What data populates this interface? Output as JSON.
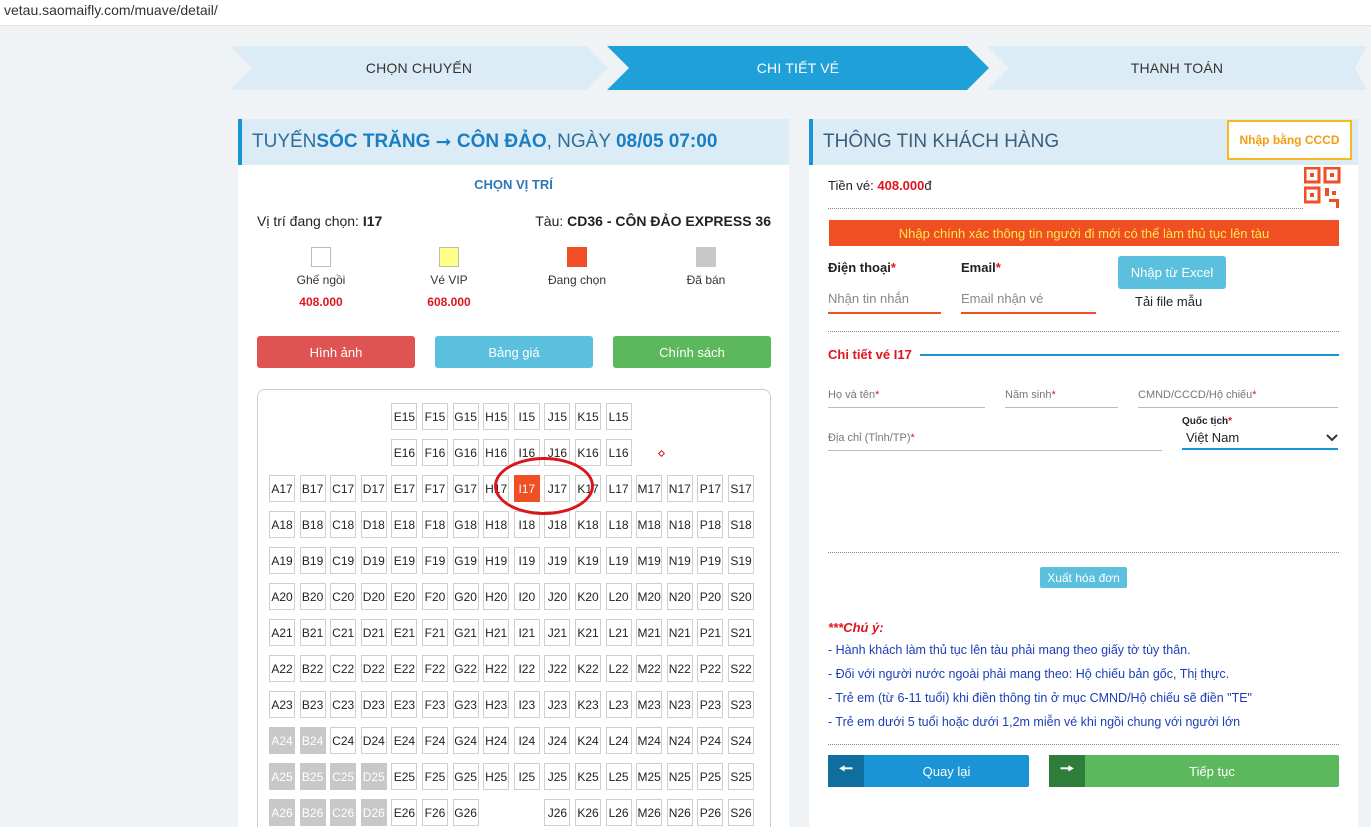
{
  "browser": {
    "url": "vetau.saomaifly.com/muave/detail/"
  },
  "steps": [
    "CHỌN CHUYẾN",
    "CHI TIẾT VÉ",
    "THANH TOÁN"
  ],
  "trip": {
    "prefix": "TUYẾN ",
    "from": "SÓC TRĂNG",
    "arrow": " ➞ ",
    "to": "CÔN ĐẢO",
    "date_prefix": ", NGÀY ",
    "datetime": "08/05 07:00"
  },
  "seat_section": {
    "title": "CHỌN VỊ TRÍ",
    "selected_label": "Vị trí đang chọn: ",
    "selected_value": "I17",
    "ship_label": "Tàu: ",
    "ship_value": "CD36 - CÔN ĐẢO EXPRESS 36"
  },
  "legend": [
    {
      "label": "Ghế ngồi",
      "price": "408.000",
      "color": "#ffffff"
    },
    {
      "label": "Vé VIP",
      "price": "608.000",
      "color": "#ffff88"
    },
    {
      "label": "Đang chọn",
      "price": "",
      "color": "#f04e23"
    },
    {
      "label": "Đã bán",
      "price": "",
      "color": "#c8c8c8"
    }
  ],
  "buttons": {
    "images": "Hình ảnh",
    "prices": "Bảng giá",
    "policy": "Chính sách"
  },
  "seatmap": {
    "columns": [
      "A",
      "B",
      "C",
      "D",
      "E",
      "F",
      "G",
      "H",
      "I",
      "J",
      "K",
      "L",
      "M",
      "N",
      "P",
      "S"
    ],
    "rows": [
      {
        "row": "15",
        "seats": [
          "E",
          "F",
          "G",
          "H",
          "I",
          "J",
          "K",
          "L"
        ]
      },
      {
        "row": "16",
        "seats": [
          "E",
          "F",
          "G",
          "H",
          "I",
          "J",
          "K",
          "L"
        ]
      },
      {
        "row": "17",
        "seats": [
          "A",
          "B",
          "C",
          "D",
          "E",
          "F",
          "G",
          "H",
          "I",
          "J",
          "K",
          "L",
          "M",
          "N",
          "P",
          "S"
        ]
      },
      {
        "row": "18",
        "seats": [
          "A",
          "B",
          "C",
          "D",
          "E",
          "F",
          "G",
          "H",
          "I",
          "J",
          "K",
          "L",
          "M",
          "N",
          "P",
          "S"
        ]
      },
      {
        "row": "19",
        "seats": [
          "A",
          "B",
          "C",
          "D",
          "E",
          "F",
          "G",
          "H",
          "I",
          "J",
          "K",
          "L",
          "M",
          "N",
          "P",
          "S"
        ]
      },
      {
        "row": "20",
        "seats": [
          "A",
          "B",
          "C",
          "D",
          "E",
          "F",
          "G",
          "H",
          "I",
          "J",
          "K",
          "L",
          "M",
          "N",
          "P",
          "S"
        ]
      },
      {
        "row": "21",
        "seats": [
          "A",
          "B",
          "C",
          "D",
          "E",
          "F",
          "G",
          "H",
          "I",
          "J",
          "K",
          "L",
          "M",
          "N",
          "P",
          "S"
        ]
      },
      {
        "row": "22",
        "seats": [
          "A",
          "B",
          "C",
          "D",
          "E",
          "F",
          "G",
          "H",
          "I",
          "J",
          "K",
          "L",
          "M",
          "N",
          "P",
          "S"
        ]
      },
      {
        "row": "23",
        "seats": [
          "A",
          "B",
          "C",
          "D",
          "E",
          "F",
          "G",
          "H",
          "I",
          "J",
          "K",
          "L",
          "M",
          "N",
          "P",
          "S"
        ]
      },
      {
        "row": "24",
        "seats": [
          "A",
          "B",
          "C",
          "D",
          "E",
          "F",
          "G",
          "H",
          "I",
          "J",
          "K",
          "L",
          "M",
          "N",
          "P",
          "S"
        ]
      },
      {
        "row": "25",
        "seats": [
          "A",
          "B",
          "C",
          "D",
          "E",
          "F",
          "G",
          "H",
          "I",
          "J",
          "K",
          "L",
          "M",
          "N",
          "P",
          "S"
        ]
      },
      {
        "row": "26",
        "seats": [
          "A",
          "B",
          "C",
          "D",
          "E",
          "F",
          "G",
          "J",
          "K",
          "L",
          "M",
          "N",
          "P",
          "S"
        ]
      }
    ],
    "sold": [
      "A24",
      "B24",
      "A25",
      "B25",
      "C25",
      "D25",
      "A26",
      "B26",
      "C26",
      "D26"
    ],
    "selected": "I17"
  },
  "customer": {
    "title": "THÔNG TIN KHÁCH HÀNG",
    "cccd_button": "Nhập bằng CCCD",
    "price_label": "Tiền vé: ",
    "price_value": "408.000",
    "price_unit": "đ",
    "warning": "Nhập chính xác thông tin người đi mới có thể làm thủ tục lên tàu",
    "phone_label": "Điện thoại",
    "phone_placeholder": "Nhận tin nhắn",
    "email_label": "Email",
    "email_placeholder": "Email nhận vé",
    "excel_button": "Nhập từ Excel",
    "template_link": "Tải file mẫu",
    "ticket_detail_title": "Chi tiết vé I17",
    "fullname_label": "Họ và tên",
    "birth_label": "Năm sinh",
    "id_label": "CMND/CCCD/Hộ chiếu",
    "address_label": "Địa chỉ (Tỉnh/TP)",
    "nationality_label": "Quốc tịch",
    "nationality_value": "Việt Nam",
    "invoice_button": "Xuất hóa đơn",
    "required_mark": "*"
  },
  "notes": {
    "title": "***Chú ý:",
    "items": [
      "- Hành khách làm thủ tục lên tàu phải mang theo giấy tờ tùy thân.",
      "- Đối với người nước ngoài phải mang theo: Hộ chiếu bản gốc, Thị thực.",
      "- Trẻ em (từ 6-11 tuổi) khi điền thông tin ở mục CMND/Hộ chiếu sẽ điền \"TE\"",
      "- Trẻ em dưới 5 tuổi hoặc dưới 1,2m miễn vé khi ngồi chung với người lớn"
    ]
  },
  "nav": {
    "back": "Quay lại",
    "next": "Tiếp tục"
  },
  "colors": {
    "accent": "#1fa0d8",
    "selected": "#f04e23",
    "sold": "#c8c8c8",
    "red_button": "#e05353",
    "blue_button": "#5bc0de",
    "green_button": "#5cb85c"
  }
}
